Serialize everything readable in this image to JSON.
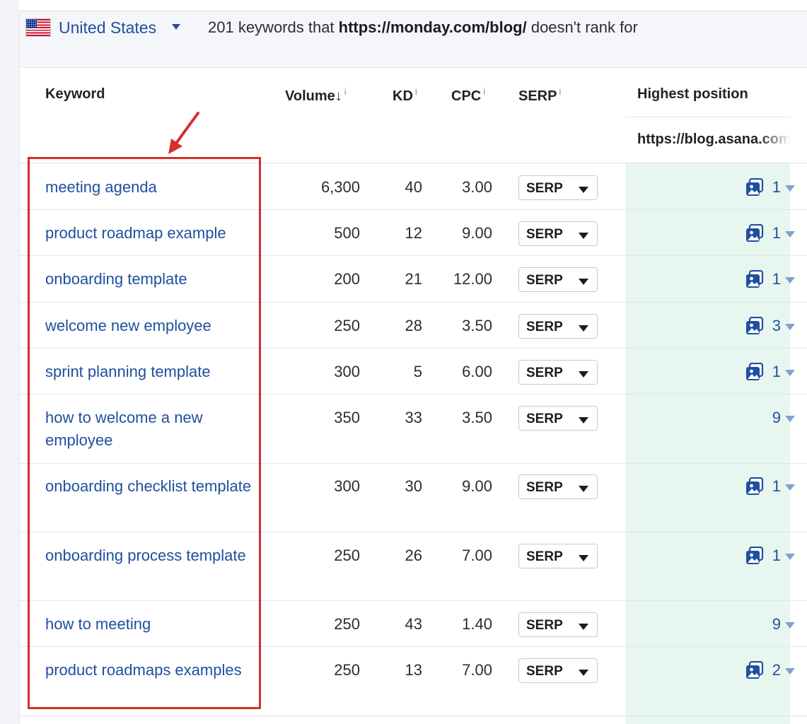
{
  "filter_bar": {
    "country": "United States",
    "summary_prefix": "201 keywords that",
    "summary_url": "https://monday.com/blog/",
    "summary_suffix": "doesn't rank for"
  },
  "table": {
    "headers": {
      "keyword": "Keyword",
      "volume": "Volume",
      "kd": "KD",
      "cpc": "CPC",
      "serp": "SERP",
      "highest_position": "Highest position",
      "info_mark": "i"
    },
    "sort_indicator": "↓",
    "competitor_url": "https://blog.asana.com",
    "serp_button_label": "SERP",
    "rows": [
      {
        "keyword": "meeting agenda",
        "volume": "6,300",
        "kd": "40",
        "cpc": "3.00",
        "position": "1",
        "feature_icon": true
      },
      {
        "keyword": "product roadmap example",
        "volume": "500",
        "kd": "12",
        "cpc": "9.00",
        "position": "1",
        "feature_icon": true
      },
      {
        "keyword": "onboarding template",
        "volume": "200",
        "kd": "21",
        "cpc": "12.00",
        "position": "1",
        "feature_icon": true
      },
      {
        "keyword": "welcome new employee",
        "volume": "250",
        "kd": "28",
        "cpc": "3.50",
        "position": "3",
        "feature_icon": true
      },
      {
        "keyword": "sprint planning template",
        "volume": "300",
        "kd": "5",
        "cpc": "6.00",
        "position": "1",
        "feature_icon": true
      },
      {
        "keyword": "how to welcome a new employee",
        "volume": "350",
        "kd": "33",
        "cpc": "3.50",
        "position": "9",
        "feature_icon": false
      },
      {
        "keyword": "onboarding checklist template",
        "volume": "300",
        "kd": "30",
        "cpc": "9.00",
        "position": "1",
        "feature_icon": true
      },
      {
        "keyword": "onboarding process template",
        "volume": "250",
        "kd": "26",
        "cpc": "7.00",
        "position": "1",
        "feature_icon": true
      },
      {
        "keyword": "how to meeting",
        "volume": "250",
        "kd": "43",
        "cpc": "1.40",
        "position": "9",
        "feature_icon": false
      },
      {
        "keyword": "product roadmaps examples",
        "volume": "250",
        "kd": "13",
        "cpc": "7.00",
        "position": "2",
        "feature_icon": true
      }
    ]
  },
  "colors": {
    "link": "#1f4f9e",
    "highlight_box": "#d3302a",
    "highest_column_bg": "#e8f6f0"
  },
  "icons": {
    "flag": "us-flag-icon",
    "serp_feature": "image-pack-icon",
    "position_dropdown": "chevron-down-icon",
    "annotation_arrow": "arrow-icon"
  }
}
